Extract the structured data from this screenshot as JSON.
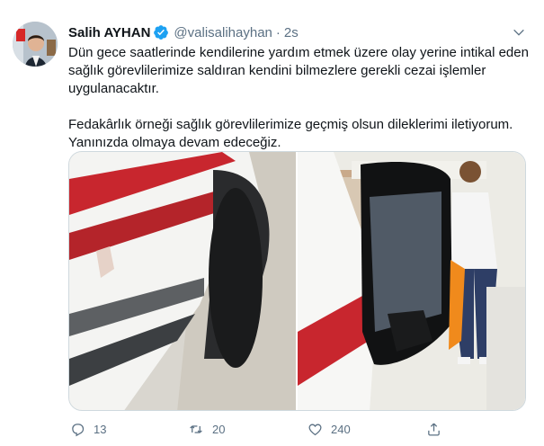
{
  "tweet": {
    "author_name": "Salih AYHAN",
    "author_handle": "@valisalihayhan",
    "separator": "·",
    "time": "2s",
    "verified_icon": "verified-badge-icon",
    "text_paragraph_1": "Dün gece saatlerinde kendilerine yardım etmek üzere olay yerine intikal eden sağlık görevlilerimize saldıran kendini bilmezlere gerekli cezai işlemler uygulanacaktır.",
    "text_paragraph_2": "Fedakârlık örneği sağlık görevlilerimize geçmiş olsun dileklerimi iletiyorum. Yanınızda olmaya devam edeceğiz.",
    "media": [
      {
        "description_icon": "ambulance-side-photo"
      },
      {
        "description_icon": "broken-mirror-photo"
      }
    ]
  },
  "actions": {
    "reply_count": "13",
    "retweet_count": "20",
    "like_count": "240"
  },
  "colors": {
    "accent": "#1da1f2",
    "muted": "#5b7083",
    "text": "#0f1419"
  }
}
